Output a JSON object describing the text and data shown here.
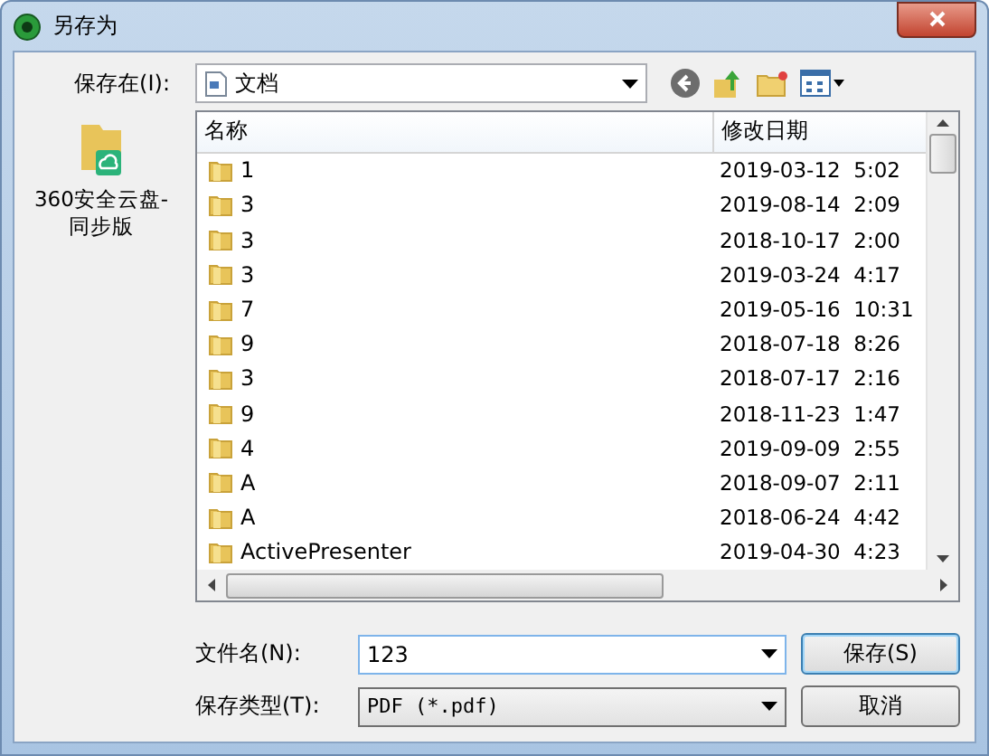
{
  "window": {
    "title": "另存为"
  },
  "location": {
    "label": "保存在(I):",
    "value": "文档"
  },
  "places": [
    {
      "label": "360安全云盘-同步版"
    }
  ],
  "file_list": {
    "columns": [
      "名称",
      "修改日期"
    ],
    "rows": [
      {
        "name": "1",
        "modified": "2019-03-12  5:02"
      },
      {
        "name": "3",
        "modified": "2019-08-14  2:09"
      },
      {
        "name": "3",
        "modified": "2018-10-17  2:00"
      },
      {
        "name": "3",
        "modified": "2019-03-24  4:17"
      },
      {
        "name": "7",
        "modified": "2019-05-16  10:31"
      },
      {
        "name": "9",
        "modified": "2018-07-18  8:26"
      },
      {
        "name": "3",
        "modified": "2018-07-17  2:16"
      },
      {
        "name": "9",
        "modified": "2018-11-23  1:47"
      },
      {
        "name": "4",
        "modified": "2019-09-09  2:55"
      },
      {
        "name": "A",
        "modified": "2018-09-07  2:11"
      },
      {
        "name": "A",
        "modified": "2018-06-24  4:42"
      },
      {
        "name": "ActivePresenter",
        "modified": "2019-04-30  4:23"
      }
    ]
  },
  "file_name": {
    "label": "文件名(N):",
    "value": "123"
  },
  "file_type": {
    "label": "保存类型(T):",
    "value": "PDF (*.pdf)"
  },
  "buttons": [
    {
      "label": "保存(S)",
      "default": true
    },
    {
      "label": "取消",
      "default": false
    }
  ]
}
